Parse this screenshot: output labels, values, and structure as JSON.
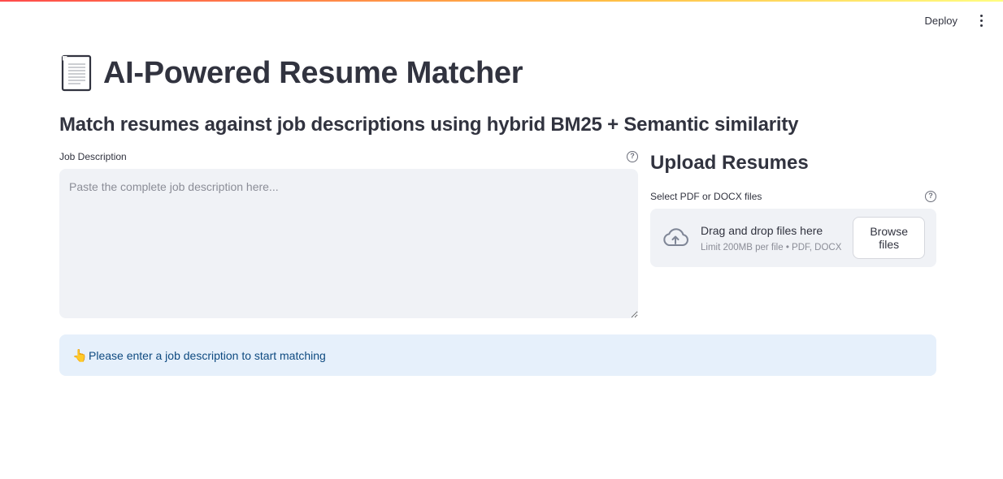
{
  "header": {
    "deploy_label": "Deploy",
    "menu_icon": "kebab-menu-icon"
  },
  "page": {
    "title_icon": "document-icon",
    "title": "AI-Powered Resume Matcher",
    "subtitle": "Match resumes against job descriptions using hybrid BM25 + Semantic similarity"
  },
  "job_description": {
    "label": "Job Description",
    "placeholder": "Paste the complete job description here...",
    "value": "",
    "help_icon": "help-circle-icon"
  },
  "upload": {
    "heading": "Upload Resumes",
    "label": "Select PDF or DOCX files",
    "help_icon": "help-circle-icon",
    "dropzone_icon": "cloud-upload-icon",
    "dropzone_title": "Drag and drop files here",
    "dropzone_limit": "Limit 200MB per file • PDF, DOCX",
    "browse_label": "Browse files"
  },
  "info": {
    "icon": "pointing-hand-icon",
    "message": "Please enter a job description to start matching",
    "bg_color": "#e6f0fb",
    "text_color": "#0e4a80"
  }
}
